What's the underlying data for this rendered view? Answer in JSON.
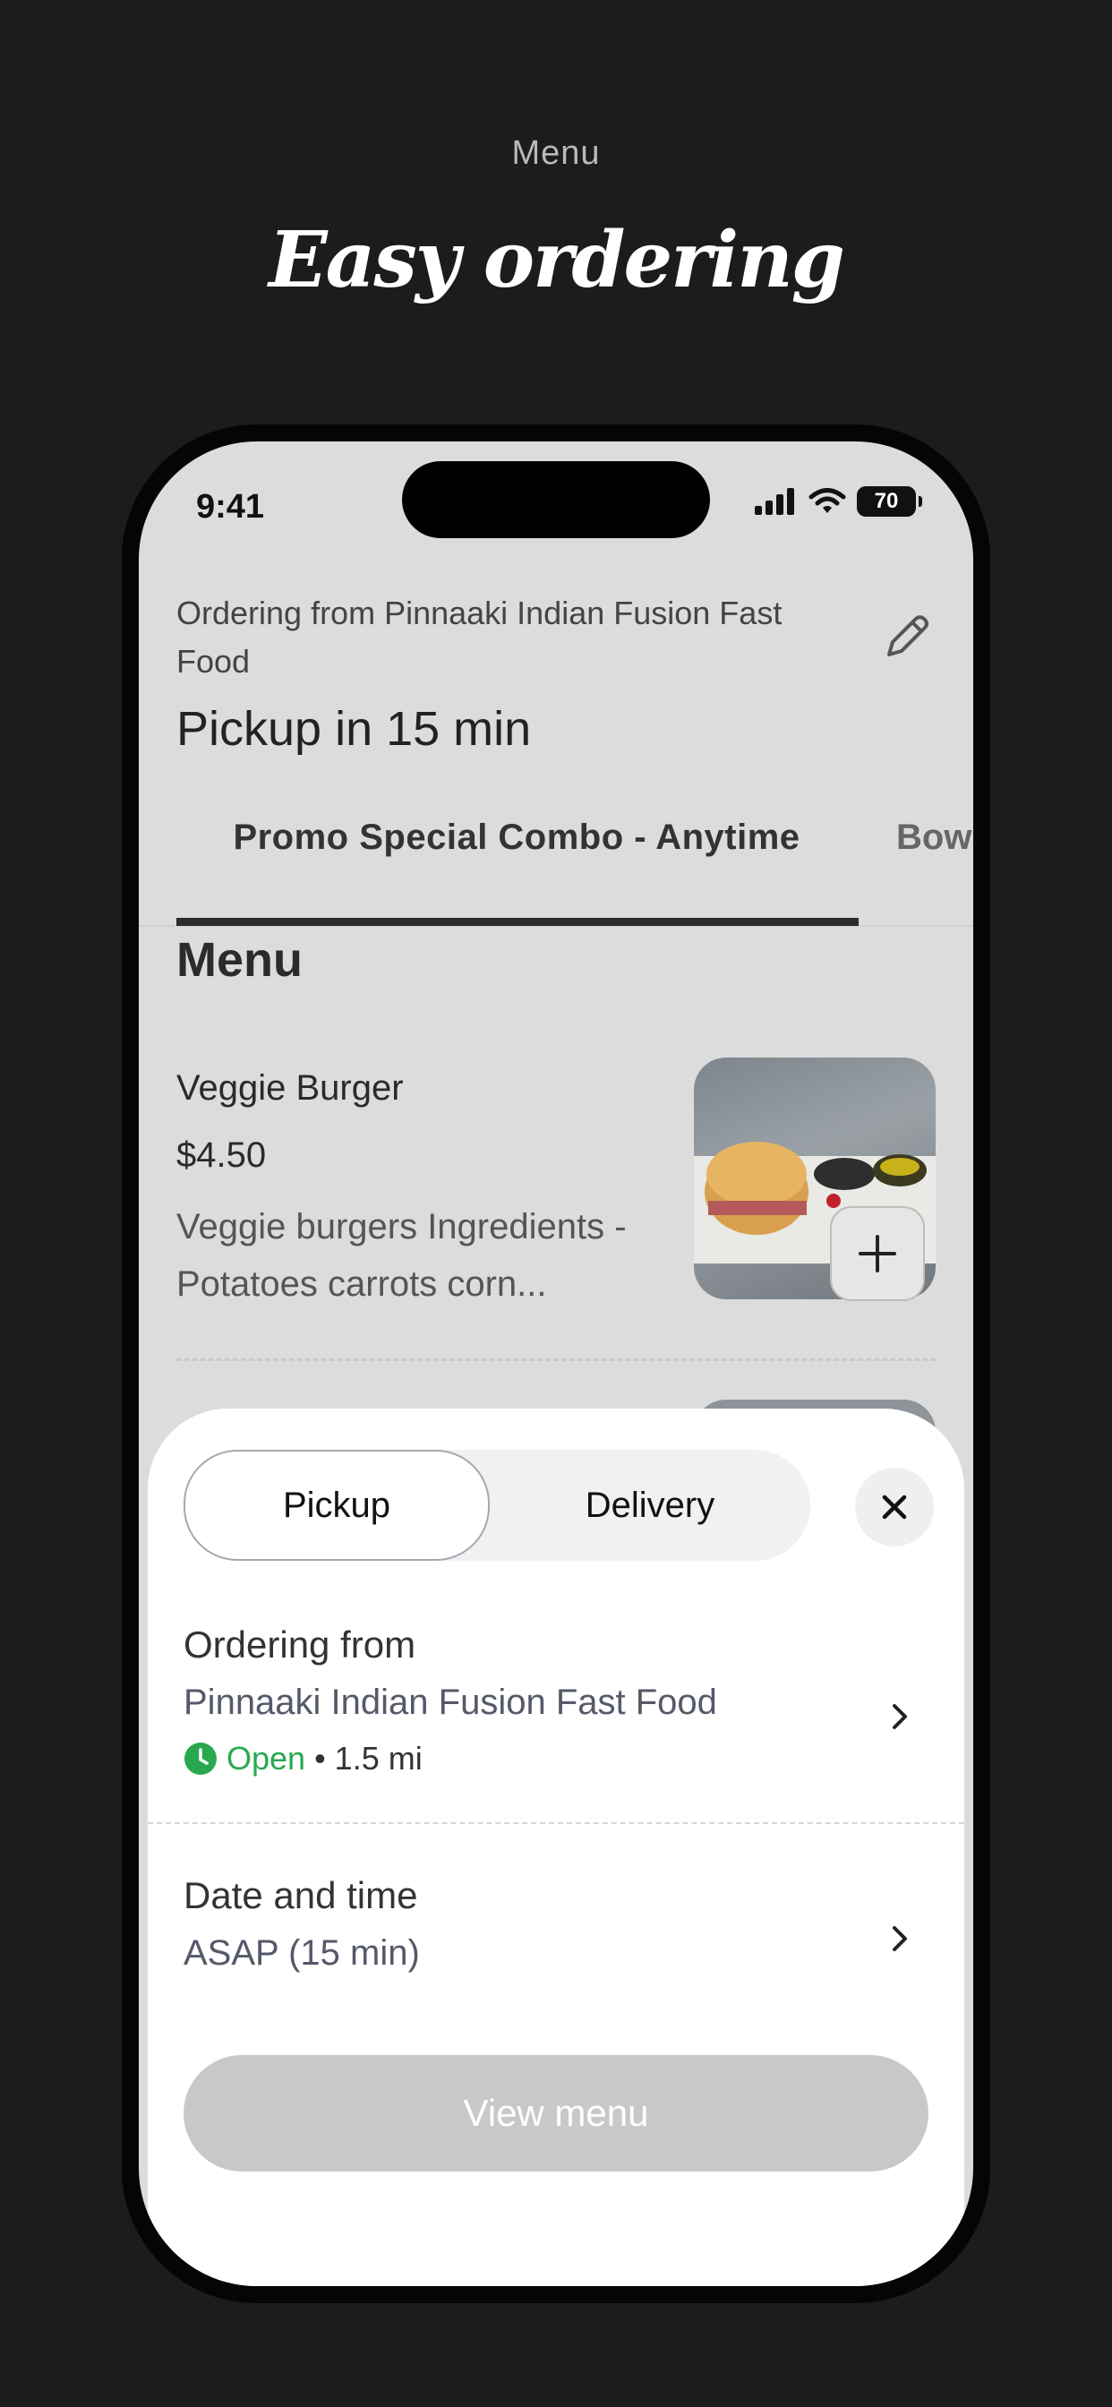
{
  "promo": {
    "subtitle": "Menu",
    "title": "Easy ordering"
  },
  "status_bar": {
    "time": "9:41",
    "battery": "70"
  },
  "header": {
    "ordering_from": "Ordering from Pinnaaki Indian Fusion Fast Food",
    "pickup_time": "Pickup in 15 min"
  },
  "tabs": [
    {
      "label": "Promo Special Combo - Anytime",
      "active": true
    },
    {
      "label": "Bow"
    }
  ],
  "menu": {
    "heading": "Menu",
    "items": [
      {
        "name": "Veggie Burger",
        "price": "$4.50",
        "description": "Veggie burgers Ingredients - Potatoes carrots corn..."
      }
    ]
  },
  "sheet": {
    "segment": {
      "pickup": "Pickup",
      "delivery": "Delivery",
      "selected": "Pickup"
    },
    "ordering": {
      "label": "Ordering from",
      "store": "Pinnaaki Indian Fusion Fast Food",
      "status": "Open",
      "distance": "• 1.5 mi"
    },
    "datetime": {
      "label": "Date and time",
      "value": "ASAP (15 min)"
    },
    "cta": "View menu"
  },
  "colors": {
    "open_green": "#2aa84f",
    "page_bg": "#1c1c1c",
    "button_disabled": "#c8c8c8"
  }
}
